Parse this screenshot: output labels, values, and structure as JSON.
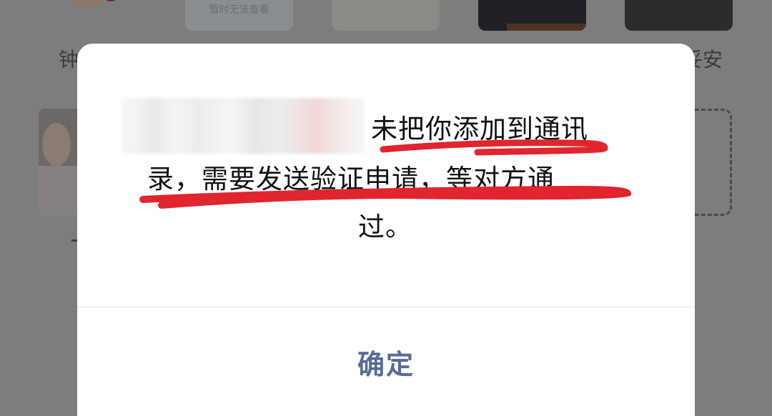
{
  "background": {
    "unavailable_text": "暂时无法查看",
    "name_left": "钟",
    "name_right": "妥安"
  },
  "dialog": {
    "message_line_1": "未把你添加到通讯",
    "message_line_2": "录，需要发送验证申请，等对方通",
    "message_line_3": "过。",
    "confirm_label": "确定"
  },
  "colors": {
    "confirm_text": "#576b95",
    "annotation_underline": "#e0252f",
    "overlay": "#7d7d7d"
  }
}
